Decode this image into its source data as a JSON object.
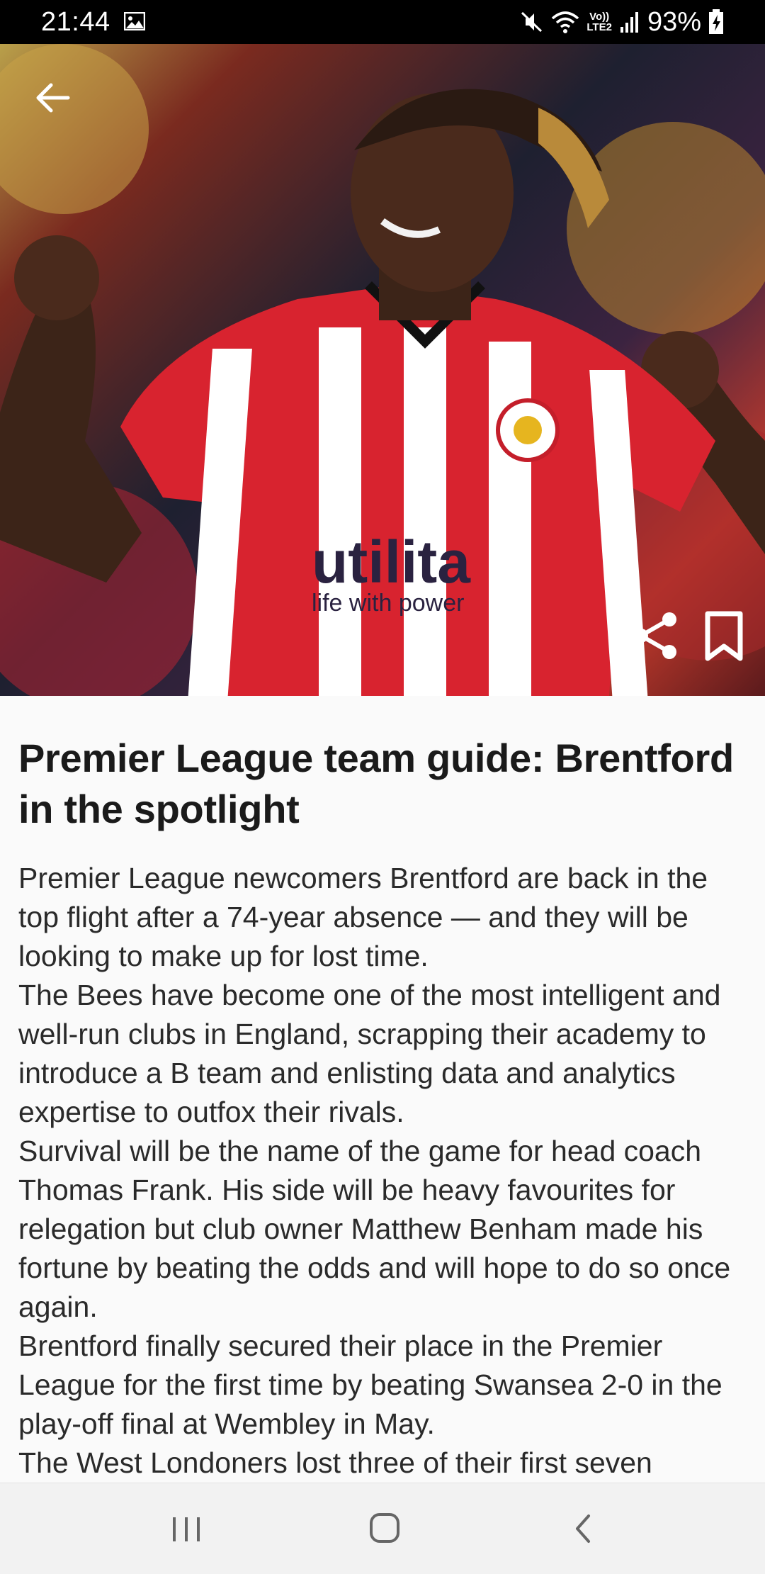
{
  "status_bar": {
    "time": "21:44",
    "network_label_top": "Vo))",
    "network_label_bottom": "LTE2",
    "battery": "93%",
    "icons": [
      "gallery-icon",
      "mute-icon",
      "wifi-icon",
      "signal-icon",
      "battery-icon"
    ]
  },
  "hero": {
    "icons": [
      "back-arrow-icon",
      "share-icon",
      "bookmark-icon"
    ]
  },
  "article": {
    "title": "Premier League team guide: Brentford in the spotlight",
    "paragraphs": [
      "Premier League newcomers Brentford are back in the top flight after a 74-year absence — and they will be looking to make up for lost time.",
      "The Bees have become one of the most intelligent and well-run clubs in England, scrapping their academy to introduce a B team and enlisting data and analytics expertise to outfox their rivals.",
      "Survival will be the name of the game for head coach Thomas Frank. His side will be heavy favourites for relegation but club owner Matthew Benham made his fortune by beating the odds and will hope to do so once again.",
      "Brentford finally secured their place in the Premier League for the first time by beating Swansea 2-0 in the play-off final at Wembley in May.",
      "The West Londoners lost three of their first seven"
    ]
  },
  "nav_bar": {
    "icons": [
      "recents-icon",
      "home-icon",
      "back-icon"
    ]
  },
  "colors": {
    "status_bar_bg": "#000000",
    "page_bg": "#fafafa",
    "title_text": "#1a1a1a",
    "body_text": "#2a2a2a",
    "nav_bar_bg": "#f2f2f2"
  }
}
